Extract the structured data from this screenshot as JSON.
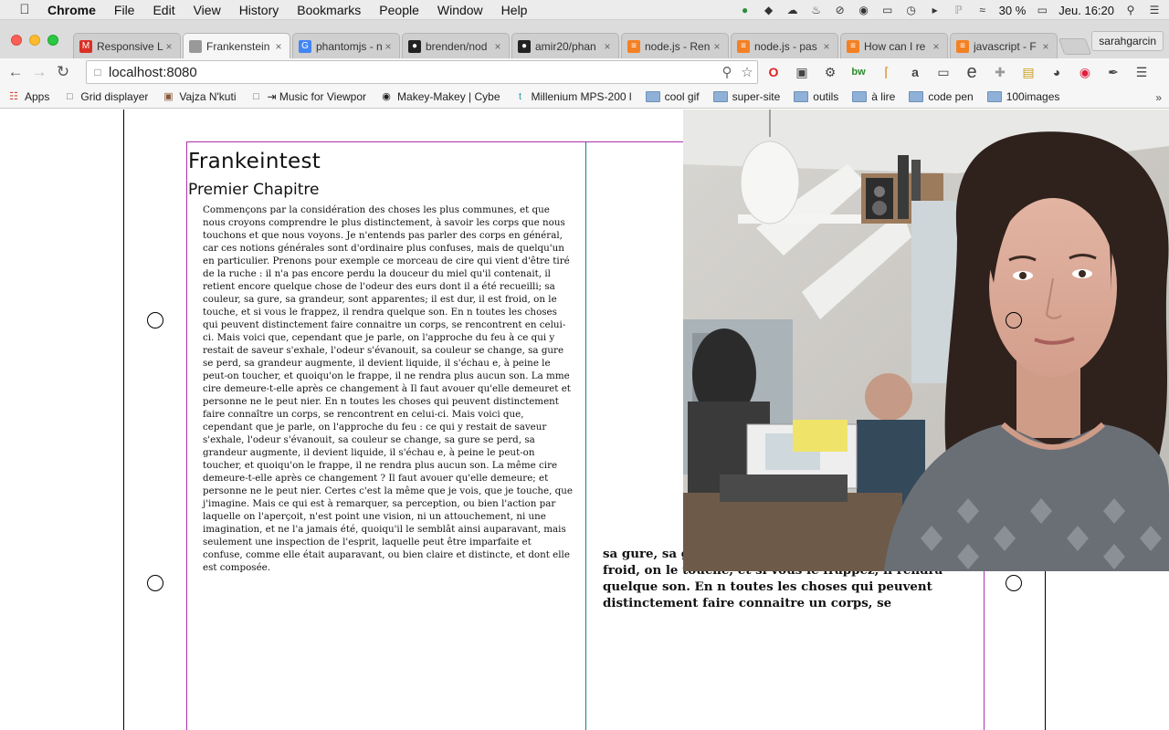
{
  "menubar": {
    "apple_icon": "apple-logo",
    "items": [
      "Chrome",
      "File",
      "Edit",
      "View",
      "History",
      "Bookmarks",
      "People",
      "Window",
      "Help"
    ],
    "battery": "30 %",
    "clock": "Jeu. 16:20"
  },
  "tabs": [
    {
      "title": "Responsive L",
      "icon": "gmail-icon",
      "color": "#d93025",
      "glyph": "M"
    },
    {
      "title": "Frankenstein",
      "icon": "page-icon",
      "color": "#999999",
      "glyph": "",
      "active": true
    },
    {
      "title": "phantomjs - n",
      "icon": "google-icon",
      "color": "#4285f4",
      "glyph": "G"
    },
    {
      "title": "brenden/nod",
      "icon": "github-icon",
      "color": "#222222",
      "glyph": "●"
    },
    {
      "title": "amir20/phan",
      "icon": "github-icon",
      "color": "#222222",
      "glyph": "●"
    },
    {
      "title": "node.js - Ren",
      "icon": "stackoverflow-icon",
      "color": "#f48024",
      "glyph": "≡"
    },
    {
      "title": "node.js - pas",
      "icon": "stackoverflow-icon",
      "color": "#f48024",
      "glyph": "≡"
    },
    {
      "title": "How can I re",
      "icon": "stackoverflow-icon",
      "color": "#f48024",
      "glyph": "≡"
    },
    {
      "title": "javascript - F",
      "icon": "stackoverflow-icon",
      "color": "#f48024",
      "glyph": "≡"
    }
  ],
  "profile_name": "sarahgarcin",
  "omnibox": {
    "url": "localhost:8080"
  },
  "bookmarks": [
    {
      "label": "Apps",
      "type": "apps"
    },
    {
      "label": "Grid displayer",
      "type": "page"
    },
    {
      "label": "Vajza N'kuti",
      "type": "image"
    },
    {
      "label": "⇥ Music for Viewpor",
      "type": "page"
    },
    {
      "label": "Makey-Makey | Cybe",
      "type": "circle"
    },
    {
      "label": "Millenium MPS-200 l",
      "type": "tumblr"
    },
    {
      "label": "cool gif",
      "type": "folder"
    },
    {
      "label": "super-site",
      "type": "folder"
    },
    {
      "label": "outils",
      "type": "folder"
    },
    {
      "label": "à lire",
      "type": "folder"
    },
    {
      "label": "code pen",
      "type": "folder"
    },
    {
      "label": "100images",
      "type": "folder"
    }
  ],
  "document": {
    "title": "Frankeintest",
    "subtitle": "Premier Chapitre",
    "body": "Commençons par la considération des choses les plus communes, et que nous croyons comprendre le plus distinctement, à savoir les corps que nous touchons et que nous voyons. Je n'entends pas parler des corps en général, car ces notions générales sont d'ordinaire plus confuses, mais de quelqu'un en particulier. Prenons pour exemple ce morceau de cire qui vient d'être tiré de la ruche : il n'a pas encore perdu la douceur du miel qu'il contenait, il retient encore quelque chose de l'odeur des eurs dont il a été recueilli; sa couleur, sa gure, sa grandeur, sont apparentes; il est dur, il est froid, on le touche, et si vous le frappez, il rendra quelque son. En n toutes les choses qui peuvent distinctement faire connaitre un corps, se rencontrent en celui-ci. Mais voici que, cependant que je parle, on l'approche du feu à ce qui y restait de saveur s'exhale, l'odeur s'évanouit, sa couleur se change, sa gure se perd, sa grandeur augmente, il devient liquide, il s'échau e, à peine le peut-on toucher, et quoiqu'on le frappe, il ne rendra plus aucun son. La mme cire demeure-t-elle après ce changement à Il faut avouer qu'elle demeuret et personne ne le peut nier. En n toutes les choses qui peuvent distinctement faire connaître un corps, se rencontrent en celui-ci. Mais voici que, cependant que je parle, on l'approche du feu : ce qui y restait de saveur s'exhale, l'odeur s'évanouit, sa couleur se change, sa gure se perd, sa grandeur augmente, il devient liquide, il s'échau e, à peine le peut-on toucher, et quoiqu'on le frappe, il ne rendra plus aucun son. La même cire demeure-t-elle après ce changement ? Il faut avouer qu'elle demeure; et personne ne le peut nier. Certes c'est la même que je vois, que je touche, que j'imagine. Mais ce qui est à remarquer, sa perception, ou bien l'action par laquelle on l'aperçoit, n'est point une vision, ni un attouchement, ni une imagination, et ne l'a jamais été, quoiqu'il le semblât ainsi auparavant, mais seulement une inspection de l'esprit, laquelle peut être imparfaite et confuse, comme elle était auparavant, ou bien claire et distincte, et dont elle est composée.",
    "overflow": "sa gure, sa grandeur, sont apparentes; il est dur, il est froid, on le touche, et si vous le frappez, il rendra quelque son. En n toutes les choses qui peuvent distinctement faire connaitre un corps, se"
  },
  "colors": {
    "frame_magenta": "#b030b0",
    "frame_teal": "#1b7d80",
    "frame_black": "#000000"
  }
}
